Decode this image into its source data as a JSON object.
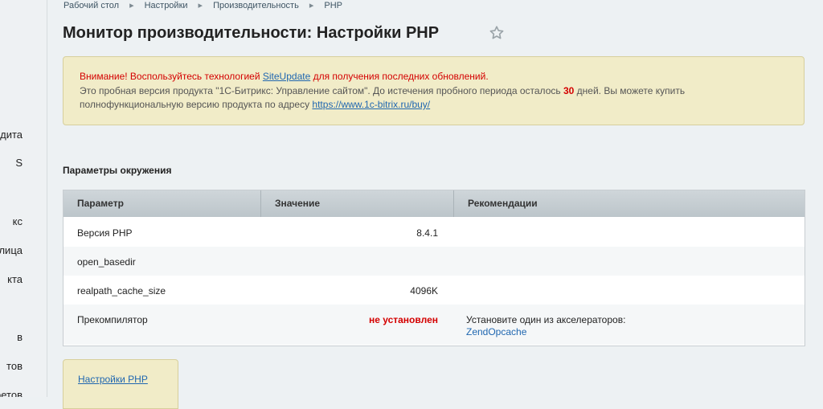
{
  "sidebar": {
    "items": [
      "дита",
      "S",
      "кс",
      "лица",
      "кта",
      "в",
      "тов",
      "ретов"
    ]
  },
  "breadcrumb": [
    "Рабочий стол",
    "Настройки",
    "Производительность",
    "PHP"
  ],
  "page": {
    "title": "Монитор производительности: Настройки PHP",
    "star_icon": "star-icon"
  },
  "notice": {
    "line1_prefix": "Внимание! Воспользуйтесь технологией ",
    "line1_link": "SiteUpdate",
    "line1_suffix": " для получения последних обновлений.",
    "line2_prefix": "Это пробная версия продукта \"1С-Битрикс: Управление сайтом\". До истечения пробного периода осталось ",
    "days": "30",
    "line2_suffix": " дней. Вы можете купить",
    "line3_prefix": "полнофункциональную версию продукта по адресу ",
    "line3_link": "https://www.1c-bitrix.ru/buy/",
    "colors": {
      "warning": "#d40000",
      "link": "#2067b0",
      "background": "#f1ecc8"
    }
  },
  "section": {
    "title": "Параметры окружения"
  },
  "table": {
    "headers": [
      "Параметр",
      "Значение",
      "Рекомендации"
    ],
    "rows": [
      {
        "param": "Версия PHP",
        "value": "8.4.1",
        "recommendation": ""
      },
      {
        "param": "open_basedir",
        "value": "",
        "recommendation": ""
      },
      {
        "param": "realpath_cache_size",
        "value": "4096K",
        "recommendation": ""
      },
      {
        "param": "Прекомпилятор",
        "value": "не установлен",
        "recommendation": "Установите один из акселераторов:",
        "recommendation_link": "ZendOpcache"
      }
    ]
  },
  "tabs": {
    "php_settings": "Настройки PHP"
  }
}
